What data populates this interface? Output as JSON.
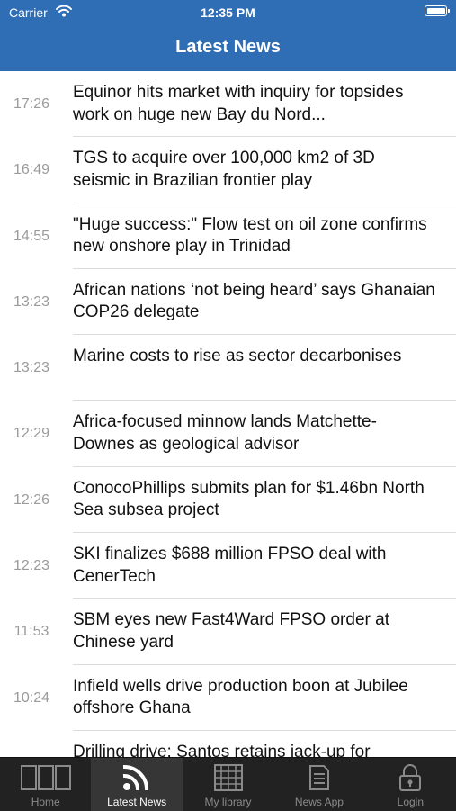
{
  "status_bar": {
    "carrier": "Carrier",
    "time": "12:35 PM"
  },
  "nav": {
    "title": "Latest News"
  },
  "news": [
    {
      "time": "17:26",
      "headline": "Equinor hits market with inquiry for topsides work on huge new Bay du Nord..."
    },
    {
      "time": "16:49",
      "headline": "TGS to acquire over 100,000 km2 of 3D seismic in Brazilian frontier play"
    },
    {
      "time": "14:55",
      "headline": "\"Huge success:\" Flow test on oil zone confirms new onshore play in Trinidad"
    },
    {
      "time": "13:23",
      "headline": "African nations ‘not being heard’ says Ghanaian COP26 delegate"
    },
    {
      "time": "13:23",
      "headline": "Marine costs to rise as sector decarbonises"
    },
    {
      "time": "12:29",
      "headline": "Africa-focused minnow lands Matchette-Downes as geological advisor"
    },
    {
      "time": "12:26",
      "headline": "ConocoPhillips submits plan for $1.46bn North Sea subsea project"
    },
    {
      "time": "12:23",
      "headline": "SKI finalizes $688 million FPSO deal with CenerTech"
    },
    {
      "time": "11:53",
      "headline": "SBM eyes new Fast4Ward FPSO order at Chinese yard"
    },
    {
      "time": "10:24",
      "headline": "Infield wells drive production boon at Jubilee offshore Ghana"
    },
    {
      "time": "",
      "headline": "Drilling drive: Santos retains jack-up for"
    }
  ],
  "tabs": [
    {
      "label": "Home",
      "icon": "home-icon"
    },
    {
      "label": "Latest News",
      "icon": "rss-icon",
      "active": true
    },
    {
      "label": "My library",
      "icon": "library-icon"
    },
    {
      "label": "News App",
      "icon": "newspaper-icon"
    },
    {
      "label": "Login",
      "icon": "lock-icon"
    }
  ],
  "colors": {
    "nav_background": "#2f6db5",
    "tabbar_background": "#222222",
    "active_tab_text": "#ffffff",
    "inactive_tab_text": "#8a8a8a"
  }
}
